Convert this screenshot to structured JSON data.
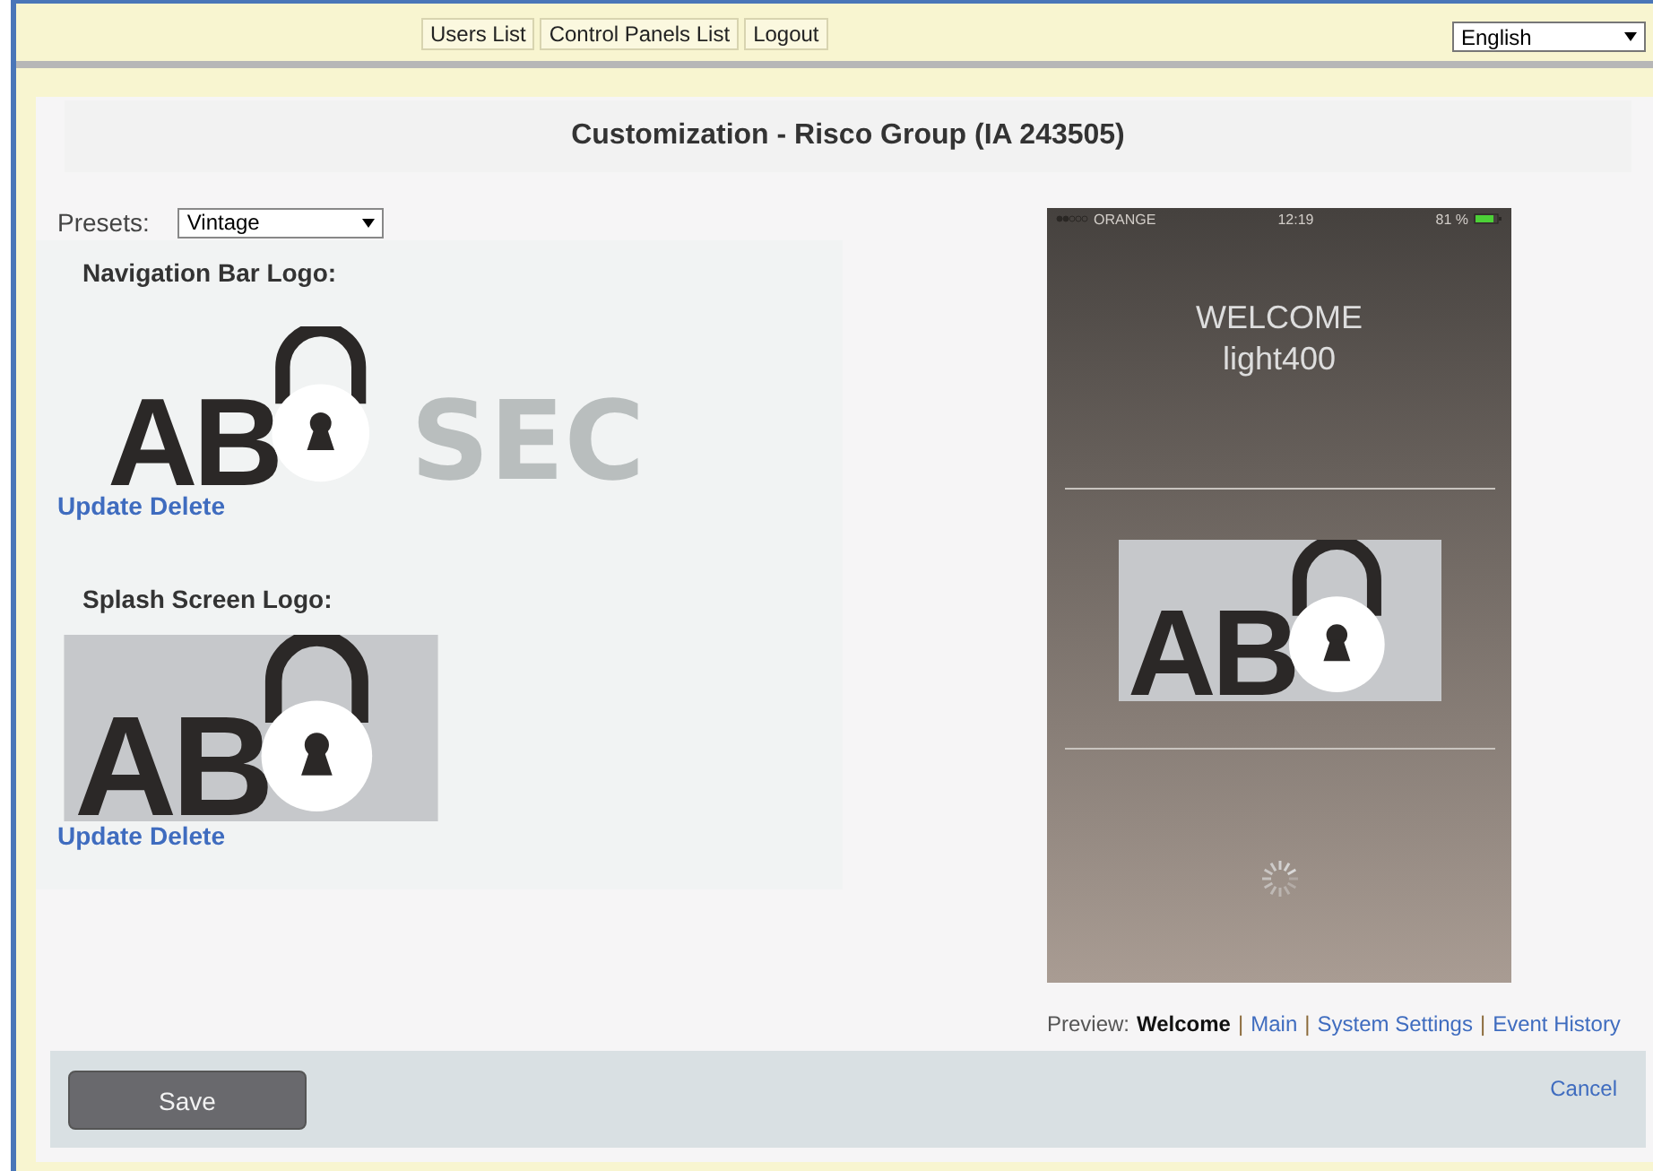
{
  "top_nav": {
    "links": [
      "Users List",
      "Control Panels List",
      "Logout"
    ],
    "language": "English"
  },
  "title": "Customization - Risco Group (IA 243505)",
  "presets": {
    "label": "Presets:",
    "value": "Vintage"
  },
  "logos": [
    {
      "heading": "Navigation Bar Logo:",
      "logo_text": "AB",
      "extra_text": "SEC",
      "background": false,
      "actions": [
        "Update",
        "Delete"
      ]
    },
    {
      "heading": "Splash Screen Logo:",
      "logo_text": "AB",
      "background": true,
      "actions": [
        "Update",
        "Delete"
      ]
    }
  ],
  "phone_preview": {
    "carrier": "ORANGE",
    "time": "12:19",
    "battery": "81 %",
    "welcome": "WELCOME",
    "user": "light400",
    "logo_text": "AB"
  },
  "preview": {
    "label": "Preview:",
    "separator": "|",
    "tabs": [
      {
        "label": "Welcome",
        "selected": true
      },
      {
        "label": "Main",
        "selected": false
      },
      {
        "label": "System Settings",
        "selected": false
      },
      {
        "label": "Event History",
        "selected": false
      }
    ]
  },
  "footer": {
    "save": "Save",
    "cancel": "Cancel"
  }
}
